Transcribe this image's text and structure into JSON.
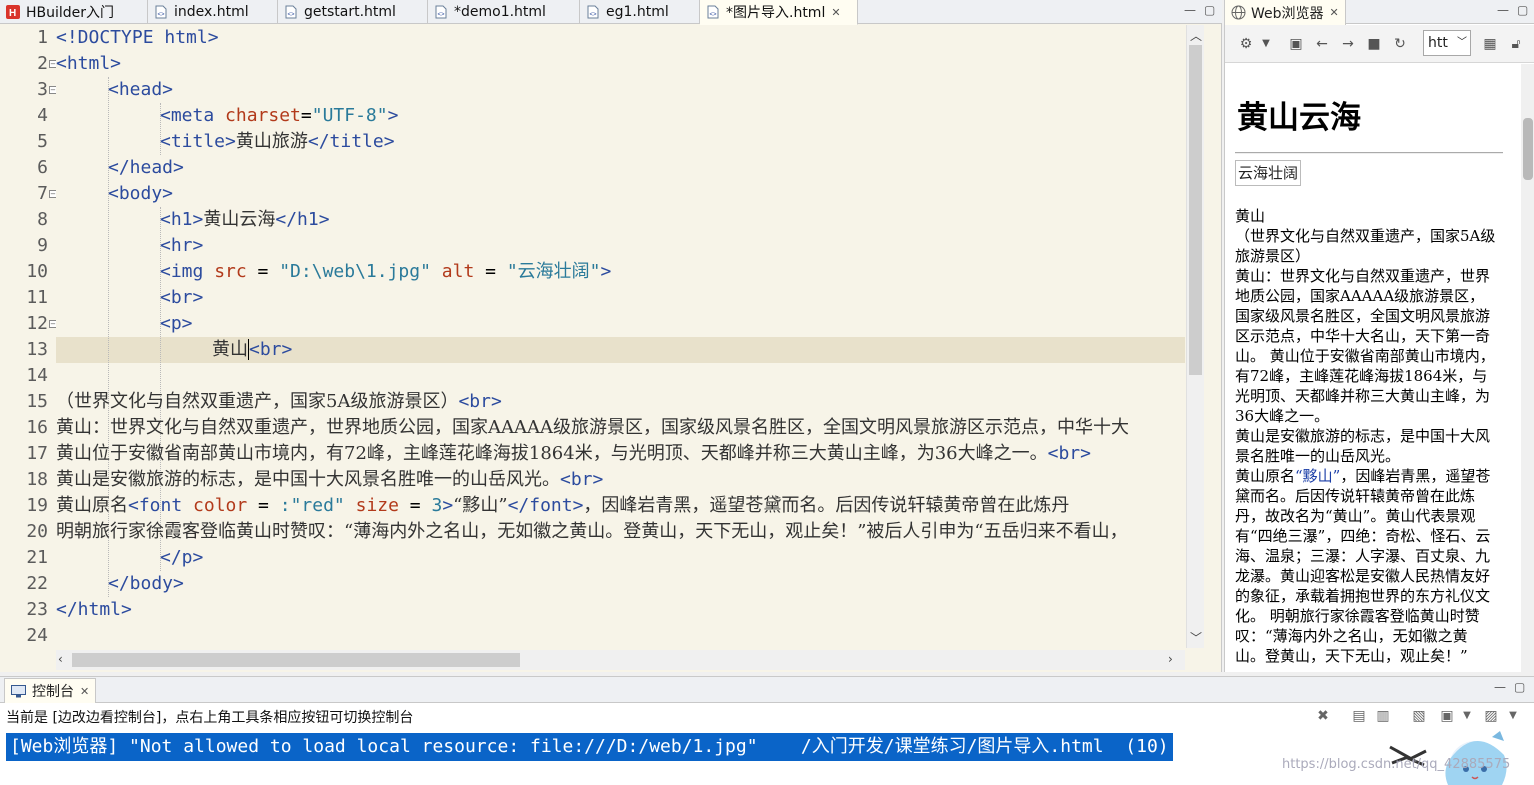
{
  "editor": {
    "tabs": [
      {
        "label": "HBuilder入门",
        "icon": "hbuilder-logo-icon"
      },
      {
        "label": "index.html",
        "icon": "html-file-icon"
      },
      {
        "label": "getstart.html",
        "icon": "html-file-icon"
      },
      {
        "label": "*demo1.html",
        "icon": "html-file-icon"
      },
      {
        "label": "eg1.html",
        "icon": "html-file-icon"
      },
      {
        "label": "*图片导入.html",
        "icon": "html-file-icon",
        "active": true
      }
    ],
    "line_numbers": [
      "1",
      "2",
      "3",
      "4",
      "5",
      "6",
      "7",
      "8",
      "9",
      "10",
      "11",
      "12",
      "13",
      "14",
      "15",
      "16",
      "17",
      "18",
      "19",
      "20",
      "21",
      "22",
      "23",
      "24"
    ],
    "code": {
      "l1_tag": "<!DOCTYPE html>",
      "l2_tag": "<html>",
      "l3_tag": "<head>",
      "l4_open": "<meta ",
      "l4_attr": "charset",
      "l4_eq": "=",
      "l4_val": "\"UTF-8\"",
      "l4_close": ">",
      "l5_open": "<title>",
      "l5_text": "黄山旅游",
      "l5_close": "</title>",
      "l6_tag": "</head>",
      "l7_tag": "<body>",
      "l8_open": "<h1>",
      "l8_text": "黄山云海",
      "l8_close": "</h1>",
      "l9_tag": "<hr>",
      "l10_open": "<img ",
      "l10_attr1": "src",
      "l10_eq1": " = ",
      "l10_val1": "\"D:\\web\\1.jpg\"",
      "l10_attr2": " alt",
      "l10_eq2": " = ",
      "l10_val2": "\"云海壮阔\"",
      "l10_close": ">",
      "l11_tag": "<br>",
      "l12_tag": "<p>",
      "l13_text": "黄山",
      "l13_tag_a": "<",
      "l13_tag_b": "br>",
      "l15_text": "（世界文化与自然双重遗产，国家5A级旅游景区）",
      "l15_tag": "<br>",
      "l16_text": "黄山：世界文化与自然双重遗产，世界地质公园，国家AAAAA级旅游景区，国家级风景名胜区，全国文明风景旅游区示范点，中华十大",
      "l17_text": "黄山位于安徽省南部黄山市境内，有72峰，主峰莲花峰海拔1864米，与光明顶、天都峰并称三大黄山主峰，为36大峰之一。",
      "l17_tag": "<br>",
      "l18_text": "黄山是安徽旅游的标志，是中国十大风景名胜唯一的山岳风光。",
      "l18_tag": "<br>",
      "l19_text_a": "黄山原名",
      "l19_open": "<font ",
      "l19_attr1": "color",
      "l19_eq1": " = ",
      "l19_val1": ":\"red\"",
      "l19_attr2": " size",
      "l19_eq2": " = ",
      "l19_val2": "3",
      "l19_close": ">",
      "l19_text_b": "“黟山”",
      "l19_end": "</font>",
      "l19_text_c": "，因峰岩青黑，遥望苍黛而名。后因传说轩辕黄帝曾在此炼丹",
      "l20_text": "明朝旅行家徐霞客登临黄山时赞叹：“薄海内外之名山，无如徽之黄山。登黄山，天下无山，观止矣！”被后人引申为“五岳归来不看山，",
      "l21_tag": "</p>",
      "l22_tag": "</body>",
      "l23_tag": "</html>"
    }
  },
  "browser": {
    "tab_label": "Web浏览器",
    "url_value": "htt",
    "page": {
      "h1": "黄山云海",
      "img_alt": "云海壮阔",
      "p_line1": "黄山",
      "p_line2": "（世界文化与自然双重遗产，国家5A级旅游景区）",
      "p_line3": "黄山：世界文化与自然双重遗产，世界地质公园，国家AAAAA级旅游景区，国家级风景名胜区，全国文明风景旅游区示范点，中华十大名山，天下第一奇山。 黄山位于安徽省南部黄山市境内，有72峰，主峰莲花峰海拔1864米，与光明顶、天都峰并称三大黄山主峰，为36大峰之一。",
      "p_line4": "黄山是安徽旅游的标志，是中国十大风景名胜唯一的山岳风光。",
      "p_line5_a": "黄山原名",
      "p_line5_font": "“黟山”",
      "p_line5_b": "，因峰岩青黑，遥望苍黛而名。后因传说轩辕黄帝曾在此炼丹，故改名为“黄山”。黄山代表景观有“四绝三瀑”，四绝：奇松、怪石、云海、温泉；三瀑：人字瀑、百丈泉、九龙瀑。黄山迎客松是安徽人民热情友好的象征，承载着拥抱世界的东方礼仪文化。 明朝旅行家徐霞客登临黄山时赞叹：“薄海内外之名山，无如徽之黄山。登黄山，天下无山，观止矣！”"
    }
  },
  "console": {
    "tab_label": "控制台",
    "status": "当前是 [边改边看控制台]，点右上角工具条相应按钮可切换控制台",
    "message": "[Web浏览器] \"Not allowed to load local resource: file:///D:/web/1.jpg\"    /入门开发/课堂练习/图片导入.html  (10)",
    "watermark": "https://blog.csdn.net/qq_42885575"
  },
  "colors": {
    "tag": "#2c4b9e",
    "attr": "#b23a1b",
    "value": "#2a7a9a",
    "current_line": "#e8e1cb",
    "editor_bg": "#f7f4e8",
    "console_highlight": "#0a64c8"
  }
}
